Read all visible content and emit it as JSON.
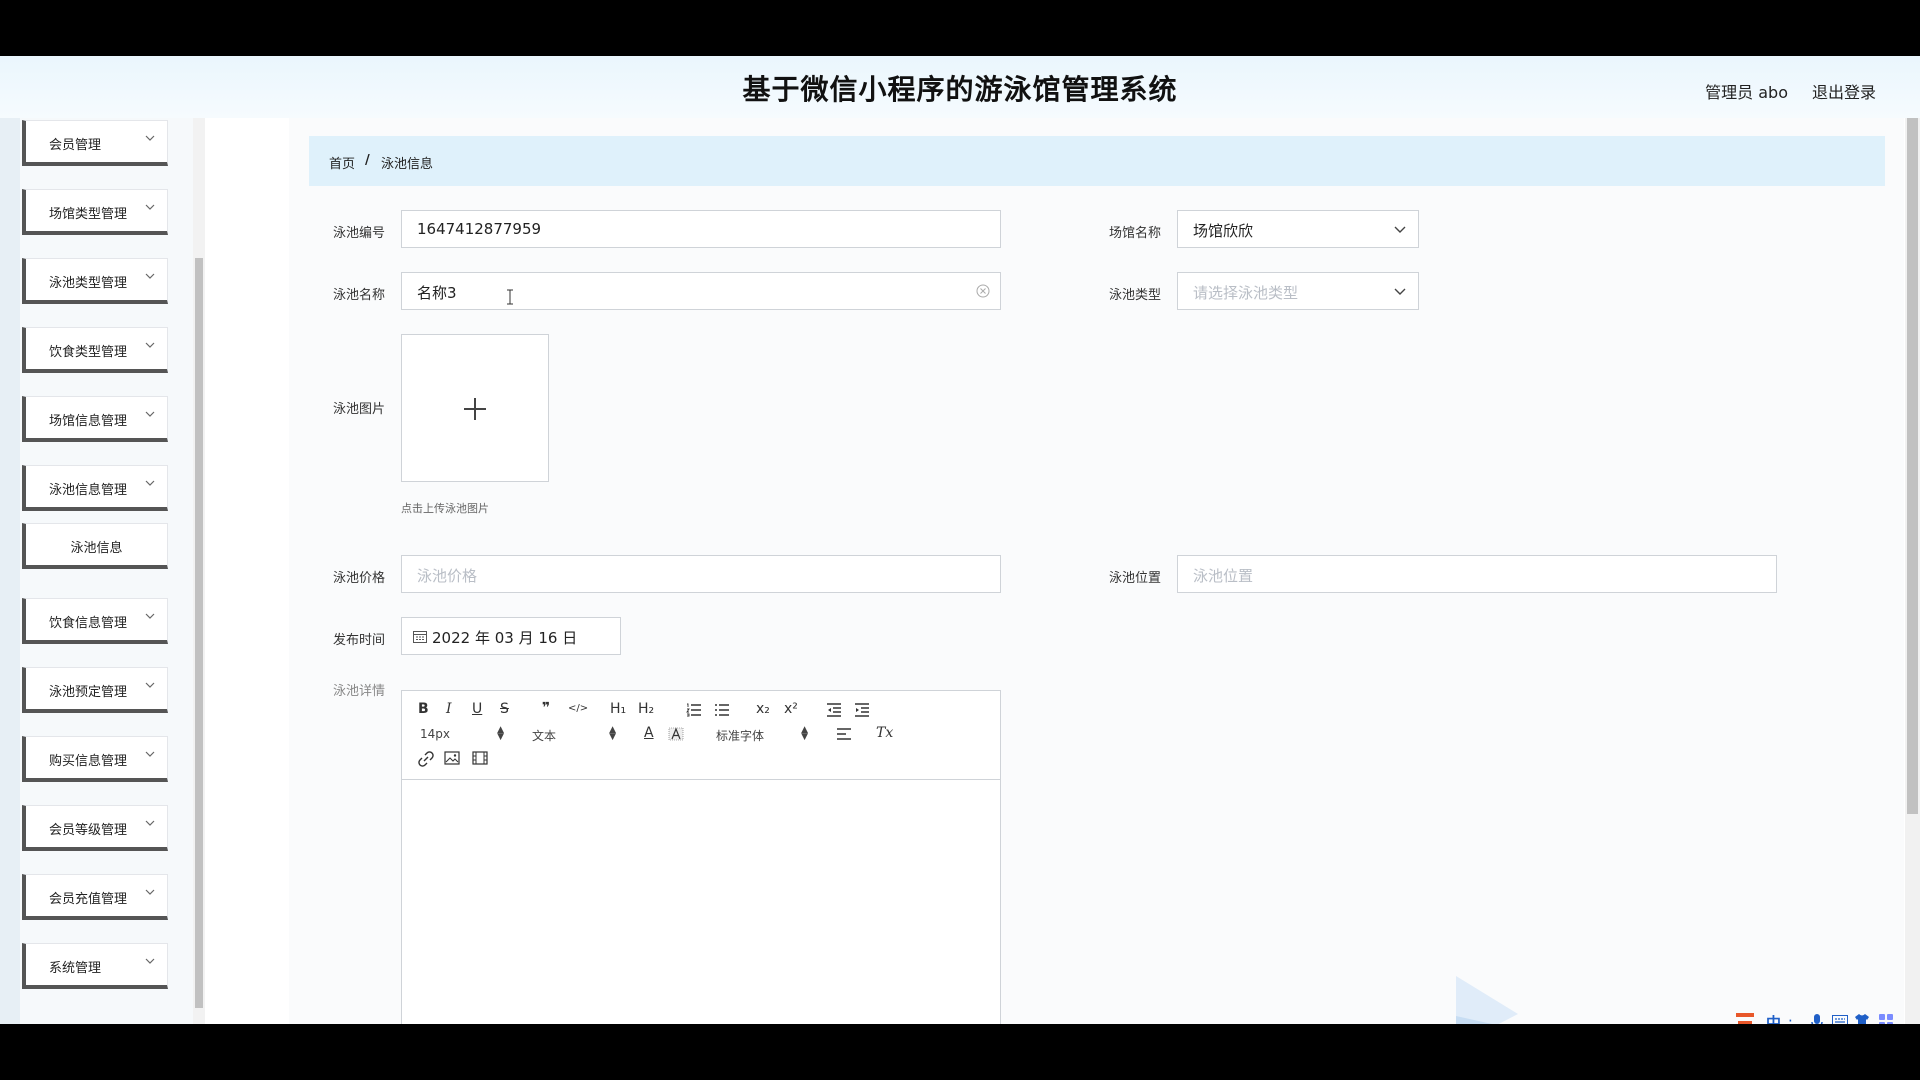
{
  "header": {
    "title": "基于微信小程序的游泳馆管理系统",
    "user": "管理员 abo",
    "logout": "退出登录"
  },
  "sidebar": {
    "items": [
      {
        "label": "会员管理"
      },
      {
        "label": "场馆类型管理"
      },
      {
        "label": "泳池类型管理"
      },
      {
        "label": "饮食类型管理"
      },
      {
        "label": "场馆信息管理"
      },
      {
        "label": "泳池信息管理"
      },
      {
        "label": "泳池信息"
      },
      {
        "label": "饮食信息管理"
      },
      {
        "label": "泳池预定管理"
      },
      {
        "label": "购买信息管理"
      },
      {
        "label": "会员等级管理"
      },
      {
        "label": "会员充值管理"
      },
      {
        "label": "系统管理"
      }
    ]
  },
  "breadcrumb": {
    "home": "首页",
    "sep": "/",
    "current": "泳池信息"
  },
  "form": {
    "pool_no": {
      "label": "泳池编号",
      "value": "1647412877959"
    },
    "venue_name": {
      "label": "场馆名称",
      "value": "场馆欣欣"
    },
    "pool_name": {
      "label": "泳池名称",
      "value": "名称3"
    },
    "pool_type": {
      "label": "泳池类型",
      "placeholder": "请选择泳池类型"
    },
    "pool_image": {
      "label": "泳池图片",
      "hint": "点击上传泳池图片"
    },
    "pool_price": {
      "label": "泳池价格",
      "placeholder": "泳池价格"
    },
    "pool_location": {
      "label": "泳池位置",
      "placeholder": "泳池位置"
    },
    "publish_time": {
      "label": "发布时间",
      "value": "2022 年 03 月 16 日"
    },
    "pool_detail": {
      "label": "泳池详情"
    }
  },
  "editor": {
    "bold": "B",
    "italic": "I",
    "underline": "U",
    "strike": "S",
    "blockquote": "❞",
    "code": "</>",
    "h1": "H₁",
    "h2": "H₂",
    "x_sub": "x₂",
    "x_sup": "x²",
    "size": "14px",
    "header_select": "文本",
    "font_color": "A",
    "font_select": "标准字体",
    "clear_format": "Tx"
  },
  "colors": {
    "header_bg": "#eaf6fd",
    "breadcrumb_bg": "#dff1fb",
    "menu_border": "#555555",
    "accent_blue": "#1f5fc7",
    "logo_orange": "#e8572a"
  }
}
